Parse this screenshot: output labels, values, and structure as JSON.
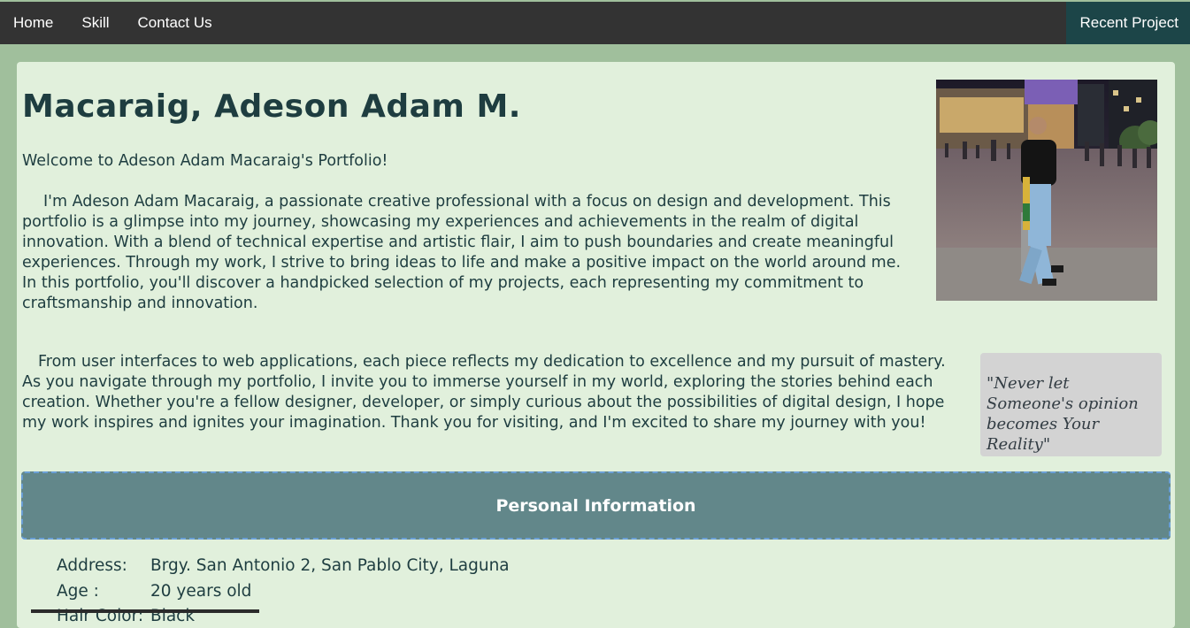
{
  "nav": {
    "items": [
      {
        "label": "Home"
      },
      {
        "label": "Skill"
      },
      {
        "label": "Contact Us"
      }
    ],
    "right_label": "Recent Project"
  },
  "profile": {
    "name": "Macaraig, Adeson Adam M.",
    "welcome": "Welcome to Adeson Adam Macaraig's Portfolio!",
    "paragraph1": "I'm Adeson Adam Macaraig, a passionate creative professional with a focus on design and development. This portfolio is a glimpse into my journey, showcasing my experiences and achievements in the realm of digital innovation. With a blend of technical expertise and artistic flair, I aim to push boundaries and create meaningful experiences. Through my work, I strive to bring ideas to life and make a positive impact on the world around me. In this portfolio, you'll discover a handpicked selection of my projects, each representing my commitment to craftsmanship and innovation.",
    "paragraph2": "From user interfaces to web applications, each piece reflects my dedication to excellence and my pursuit of mastery. As you navigate through my portfolio, I invite you to immerse yourself in my world, exploring the stories behind each creation. Whether you're a fellow designer, developer, or simply curious about the possibilities of digital design, I hope my work inspires and ignites your imagination. Thank you for visiting, and I'm excited to share my journey with you!",
    "quote": "\"Never let Someone's opinion becomes Your Reality\""
  },
  "personal_info": {
    "header": "Personal Information",
    "rows": [
      {
        "label": "Address:",
        "value": "Brgy. San Antonio 2, San Pablo City, Laguna"
      },
      {
        "label": "Age :",
        "value": "20 years old"
      },
      {
        "label": "Hair Color:",
        "value": "Black"
      }
    ]
  },
  "colors": {
    "page_bg": "#a0bf9c",
    "nav_bg": "#333333",
    "nav_active_bg": "#1c4548",
    "card_bg": "#e1f0dc",
    "heading": "#1e3d40",
    "section_header_bg": "#62878a",
    "quote_bg": "#d3d3d3"
  }
}
